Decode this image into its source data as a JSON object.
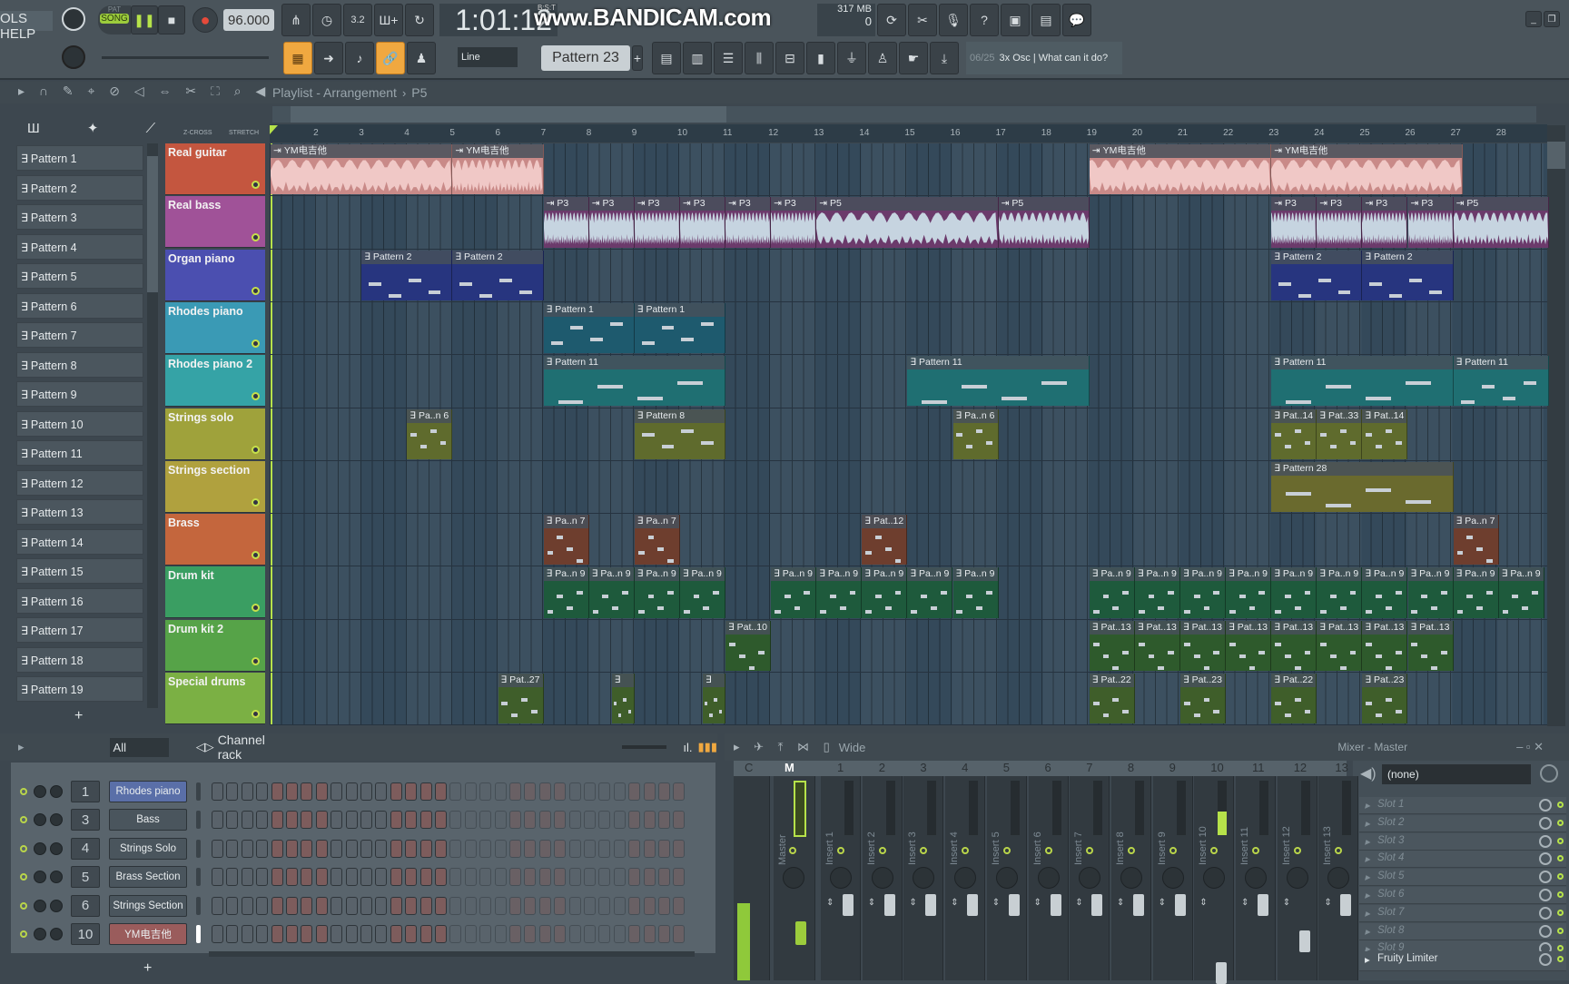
{
  "toolbar": {
    "menu": "OLS HELP",
    "pat_label": "PAT",
    "song_label": "SONG",
    "tempo": "96.000",
    "time": "1:01:12",
    "time_unit": "B:S:T",
    "watermark": "www.BANDICAM.com",
    "memory": "317 MB",
    "cpu": "0",
    "snap": "Line",
    "pattern": "Pattern 23",
    "hint_count": "06/25",
    "hint_text": "3x Osc | What can it do?"
  },
  "playlist": {
    "title": "Playlist - Arrangement",
    "breadcrumb": "P5",
    "zcross": "Z-CROSS",
    "stretch": "STRETCH",
    "add": "+"
  },
  "ruler": [
    "2",
    "3",
    "4",
    "5",
    "6",
    "7",
    "8",
    "9",
    "10",
    "11",
    "12",
    "13",
    "14",
    "15",
    "16",
    "17",
    "18",
    "19",
    "20",
    "21",
    "22",
    "23",
    "24",
    "25",
    "26",
    "27",
    "28"
  ],
  "patterns": [
    "Pattern 1",
    "Pattern 2",
    "Pattern 3",
    "Pattern 4",
    "Pattern 5",
    "Pattern 6",
    "Pattern 7",
    "Pattern 8",
    "Pattern 9",
    "Pattern 10",
    "Pattern 11",
    "Pattern 12",
    "Pattern 13",
    "Pattern 14",
    "Pattern 15",
    "Pattern 16",
    "Pattern 17",
    "Pattern 18",
    "Pattern 19"
  ],
  "tracks": [
    {
      "name": "Real guitar",
      "color": "#c4563f",
      "clip": "#c98a88",
      "clips": [
        {
          "label": "YM电吉他",
          "bar": 1,
          "len": 4,
          "audio": true
        },
        {
          "label": "YM电吉他",
          "bar": 5,
          "len": 2,
          "audio": true
        },
        {
          "label": "YM电吉他",
          "bar": 19,
          "len": 4,
          "audio": true
        },
        {
          "label": "YM电吉他",
          "bar": 23,
          "len": 4.2,
          "audio": true
        }
      ]
    },
    {
      "name": "Real bass",
      "color": "#a05298",
      "clip": "#6b3a6b",
      "clips": [
        {
          "label": "P3",
          "bar": 7,
          "len": 1,
          "audio": true
        },
        {
          "label": "P3",
          "bar": 8,
          "len": 1,
          "audio": true
        },
        {
          "label": "P3",
          "bar": 9,
          "len": 1,
          "audio": true
        },
        {
          "label": "P3",
          "bar": 10,
          "len": 1,
          "audio": true
        },
        {
          "label": "P3",
          "bar": 11,
          "len": 1,
          "audio": true
        },
        {
          "label": "P3",
          "bar": 12,
          "len": 1,
          "audio": true
        },
        {
          "label": "P5",
          "bar": 13,
          "len": 4,
          "audio": true
        },
        {
          "label": "P5",
          "bar": 17,
          "len": 2,
          "audio": true
        },
        {
          "label": "P3",
          "bar": 23,
          "len": 1,
          "audio": true
        },
        {
          "label": "P3",
          "bar": 24,
          "len": 1,
          "audio": true
        },
        {
          "label": "P3",
          "bar": 25,
          "len": 1,
          "audio": true
        },
        {
          "label": "P3",
          "bar": 26,
          "len": 1,
          "audio": true
        },
        {
          "label": "P5",
          "bar": 27,
          "len": 2.1,
          "audio": true
        }
      ]
    },
    {
      "name": "Organ piano",
      "color": "#4b4fb0",
      "clip": "#27357f",
      "clips": [
        {
          "label": "Pattern 2",
          "bar": 3,
          "len": 2
        },
        {
          "label": "Pattern 2",
          "bar": 5,
          "len": 2
        },
        {
          "label": "Pattern 2",
          "bar": 23,
          "len": 2
        },
        {
          "label": "Pattern 2",
          "bar": 25,
          "len": 2
        }
      ]
    },
    {
      "name": "Rhodes piano",
      "color": "#3a9ab5",
      "clip": "#1e5a6e",
      "clips": [
        {
          "label": "Pattern 1",
          "bar": 7,
          "len": 2
        },
        {
          "label": "Pattern 1",
          "bar": 9,
          "len": 2
        }
      ]
    },
    {
      "name": "Rhodes piano 2",
      "color": "#35a3a6",
      "clip": "#1f6f72",
      "clips": [
        {
          "label": "Pattern 11",
          "bar": 7,
          "len": 4
        },
        {
          "label": "Pattern 11",
          "bar": 15,
          "len": 4
        },
        {
          "label": "Pattern 11",
          "bar": 23,
          "len": 4
        },
        {
          "label": "Pattern 11",
          "bar": 27,
          "len": 2.1
        }
      ]
    },
    {
      "name": "Strings solo",
      "color": "#9fa23b",
      "clip": "#5f6b2d",
      "clips": [
        {
          "label": "Pa..n 6",
          "bar": 4,
          "len": 1
        },
        {
          "label": "Pattern 8",
          "bar": 9,
          "len": 2
        },
        {
          "label": "Pa..n 6",
          "bar": 16,
          "len": 1
        },
        {
          "label": "Pat..14",
          "bar": 23,
          "len": 1
        },
        {
          "label": "Pat..33",
          "bar": 24,
          "len": 1
        },
        {
          "label": "Pat..14",
          "bar": 25,
          "len": 1
        }
      ]
    },
    {
      "name": "Strings section",
      "color": "#b0a13e",
      "clip": "#6a6a2e",
      "clips": [
        {
          "label": "Pattern 28",
          "bar": 23,
          "len": 4
        }
      ]
    },
    {
      "name": "Brass",
      "color": "#c4663d",
      "clip": "#6e3e2e",
      "clips": [
        {
          "label": "Pa..n 7",
          "bar": 7,
          "len": 1
        },
        {
          "label": "Pa..n 7",
          "bar": 9,
          "len": 1
        },
        {
          "label": "Pat..12",
          "bar": 14,
          "len": 1
        },
        {
          "label": "Pa..n 7",
          "bar": 27,
          "len": 1
        }
      ]
    },
    {
      "name": "Drum kit",
      "color": "#3a9e62",
      "clip": "#1e5a3c",
      "clips": [
        {
          "label": "Pa..n 9",
          "bar": 7,
          "len": 1
        },
        {
          "label": "Pa..n 9",
          "bar": 8,
          "len": 1
        },
        {
          "label": "Pa..n 9",
          "bar": 9,
          "len": 1
        },
        {
          "label": "Pa..n 9",
          "bar": 10,
          "len": 1
        },
        {
          "label": "Pa..n 9",
          "bar": 12,
          "len": 1
        },
        {
          "label": "Pa..n 9",
          "bar": 13,
          "len": 1
        },
        {
          "label": "Pa..n 9",
          "bar": 14,
          "len": 1
        },
        {
          "label": "Pa..n 9",
          "bar": 15,
          "len": 1
        },
        {
          "label": "Pa..n 9",
          "bar": 16,
          "len": 1
        },
        {
          "label": "Pa..n 9",
          "bar": 19,
          "len": 1
        },
        {
          "label": "Pa..n 9",
          "bar": 20,
          "len": 1
        },
        {
          "label": "Pa..n 9",
          "bar": 21,
          "len": 1
        },
        {
          "label": "Pa..n 9",
          "bar": 22,
          "len": 1
        },
        {
          "label": "Pa..n 9",
          "bar": 23,
          "len": 1
        },
        {
          "label": "Pa..n 9",
          "bar": 24,
          "len": 1
        },
        {
          "label": "Pa..n 9",
          "bar": 25,
          "len": 1
        },
        {
          "label": "Pa..n 9",
          "bar": 26,
          "len": 1
        },
        {
          "label": "Pa..n 9",
          "bar": 27,
          "len": 1
        },
        {
          "label": "Pa..n 9",
          "bar": 28,
          "len": 1
        }
      ]
    },
    {
      "name": "Drum kit 2",
      "color": "#56a348",
      "clip": "#2e5a2c",
      "clips": [
        {
          "label": "Pat..10",
          "bar": 11,
          "len": 1
        },
        {
          "label": "Pat..13",
          "bar": 19,
          "len": 1
        },
        {
          "label": "Pat..13",
          "bar": 20,
          "len": 1
        },
        {
          "label": "Pat..13",
          "bar": 21,
          "len": 1
        },
        {
          "label": "Pat..13",
          "bar": 22,
          "len": 1
        },
        {
          "label": "Pat..13",
          "bar": 23,
          "len": 1
        },
        {
          "label": "Pat..13",
          "bar": 24,
          "len": 1
        },
        {
          "label": "Pat..13",
          "bar": 25,
          "len": 1
        },
        {
          "label": "Pat..13",
          "bar": 26,
          "len": 1
        }
      ]
    },
    {
      "name": "Special drums",
      "color": "#7bb044",
      "clip": "#3f5e2a",
      "clips": [
        {
          "label": "Pat..27",
          "bar": 6,
          "len": 1
        },
        {
          "label": "",
          "bar": 8.5,
          "len": 0.5
        },
        {
          "label": "",
          "bar": 10.5,
          "len": 0.5
        },
        {
          "label": "Pat..22",
          "bar": 19,
          "len": 1
        },
        {
          "label": "Pat..23",
          "bar": 21,
          "len": 1
        },
        {
          "label": "Pat..22",
          "bar": 23,
          "len": 1
        },
        {
          "label": "Pat..23",
          "bar": 25,
          "len": 1
        }
      ]
    }
  ],
  "channel_rack": {
    "filter": "All",
    "title": "Channel rack",
    "add": "+",
    "channels": [
      {
        "num": "1",
        "name": "Rhodes piano",
        "color": "#5a6fa8"
      },
      {
        "num": "3",
        "name": "Bass",
        "color": "#4a555d"
      },
      {
        "num": "4",
        "name": "Strings Solo",
        "color": "#4a555d"
      },
      {
        "num": "5",
        "name": "Brass Section",
        "color": "#4a555d"
      },
      {
        "num": "6",
        "name": "Strings Section",
        "color": "#4a555d"
      },
      {
        "num": "10",
        "name": "YM电吉他",
        "color": "#9a5c5c"
      }
    ]
  },
  "mixer": {
    "preset": "Wide",
    "title": "Mixer - Master",
    "c": "C",
    "m": "M",
    "master": "Master",
    "inserts": [
      "Insert 1",
      "Insert 2",
      "Insert 3",
      "Insert 4",
      "Insert 5",
      "Insert 6",
      "Insert 7",
      "Insert 8",
      "Insert 9",
      "Insert 10",
      "Insert 11",
      "Insert 12",
      "Insert 13"
    ],
    "insert_nums": [
      "1",
      "2",
      "3",
      "4",
      "5",
      "6",
      "7",
      "8",
      "9",
      "10",
      "11",
      "12",
      "13"
    ],
    "input": "(none)",
    "slots": [
      "Slot 1",
      "Slot 2",
      "Slot 3",
      "Slot 4",
      "Slot 5",
      "Slot 6",
      "Slot 7",
      "Slot 8",
      "Slot 9",
      "Fruity Limiter"
    ]
  }
}
